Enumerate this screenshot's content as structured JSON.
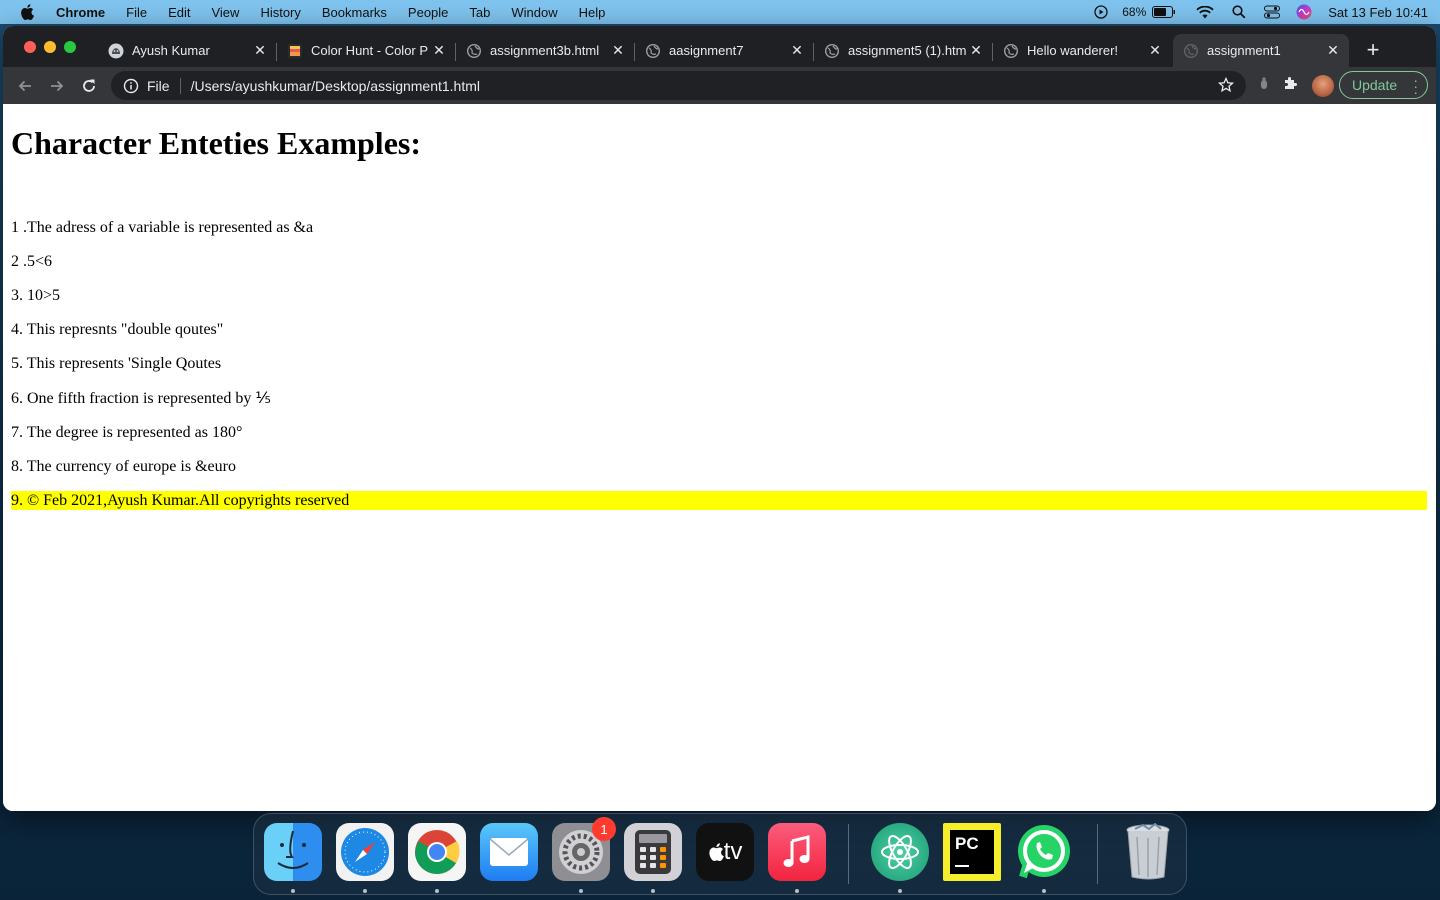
{
  "menubar": {
    "app": "Chrome",
    "items": [
      "File",
      "Edit",
      "View",
      "History",
      "Bookmarks",
      "People",
      "Tab",
      "Window",
      "Help"
    ],
    "battery": "68%",
    "clock": "Sat 13 Feb  10:41"
  },
  "tabs": [
    {
      "title": "Ayush Kumar",
      "icon": "github-icon",
      "active": false
    },
    {
      "title": "Color Hunt - Color P",
      "icon": "color-hunt-icon",
      "active": false
    },
    {
      "title": "assignment3b.html",
      "icon": "globe-icon",
      "active": false
    },
    {
      "title": "aasignment7",
      "icon": "globe-icon",
      "active": false
    },
    {
      "title": "assignment5 (1).htm",
      "icon": "globe-icon",
      "active": false
    },
    {
      "title": "Hello wanderer!",
      "icon": "globe-icon",
      "active": false
    },
    {
      "title": "assignment1",
      "icon": "globe-icon",
      "active": true
    }
  ],
  "omnibox": {
    "scheme": "File",
    "url": "/Users/ayushkumar/Desktop/assignment1.html"
  },
  "update_label": "Update",
  "page": {
    "heading": "Character Enteties Examples:",
    "paragraphs": [
      "1 .The adress of a variable is represented as &a",
      "2 .5<6",
      "3. 10>5",
      "4. This represnts \"double qoutes\"",
      "5. This represents 'Single Qoutes",
      "6. One fifth fraction is represented by ⅕",
      "7. The degree is represented as 180°",
      "8. The currency of europe is &euro",
      "9. © Feb 2021,Ayush Kumar.All copyrights reserved"
    ],
    "highlight_color": "#ffff00"
  },
  "dock": {
    "apps": [
      "finder-icon",
      "safari-icon",
      "chrome-icon",
      "mail-icon",
      "system-preferences-icon",
      "calculator-icon",
      "apple-tv-icon",
      "music-icon",
      "atom-icon",
      "pycharm-icon",
      "whatsapp-icon",
      "trash-icon"
    ],
    "system_preferences_badge": "1",
    "apple_tv_label": "tv",
    "pycharm_label": "PC"
  }
}
